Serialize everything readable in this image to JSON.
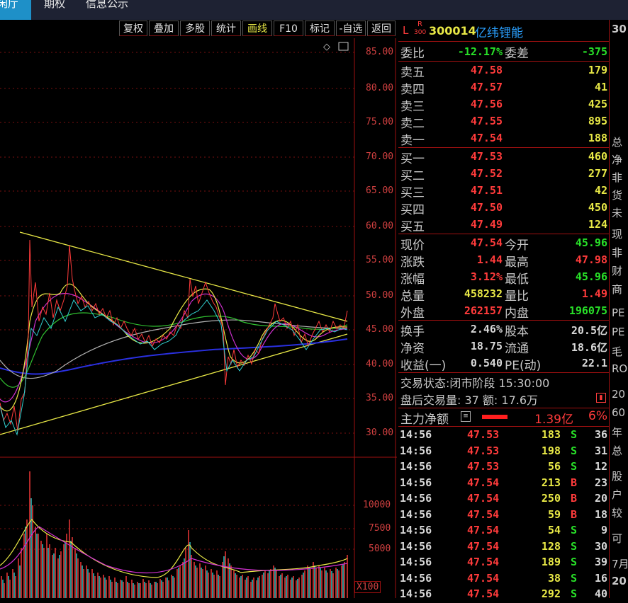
{
  "tabs": [
    "闲厅",
    "期权",
    "信息公示"
  ],
  "toolbar": [
    "复权",
    "叠加",
    "多股",
    "统计",
    "画线",
    "F10",
    "标记",
    "-自选",
    "返回"
  ],
  "price_axis": [
    "85.00",
    "80.00",
    "75.00",
    "70.00",
    "65.00",
    "60.00",
    "55.00",
    "50.00",
    "45.00",
    "40.00",
    "35.00",
    "30.00"
  ],
  "vol_axis": [
    "10000",
    "7500",
    "5000"
  ],
  "vol_unit": "X100",
  "stock": {
    "badge_l": "L",
    "badge_r": "R",
    "badge_300": "300",
    "code": "300014",
    "name": "亿纬锂能"
  },
  "weibi": {
    "label1": "委比",
    "val1": "-12.17%",
    "label2": "委差",
    "val2": "-375"
  },
  "asks": [
    {
      "label": "卖五",
      "price": "47.58",
      "vol": "179"
    },
    {
      "label": "卖四",
      "price": "47.57",
      "vol": "41"
    },
    {
      "label": "卖三",
      "price": "47.56",
      "vol": "425"
    },
    {
      "label": "卖二",
      "price": "47.55",
      "vol": "895"
    },
    {
      "label": "卖一",
      "price": "47.54",
      "vol": "188"
    }
  ],
  "bids": [
    {
      "label": "买一",
      "price": "47.53",
      "vol": "460"
    },
    {
      "label": "买二",
      "price": "47.52",
      "vol": "277"
    },
    {
      "label": "买三",
      "price": "47.51",
      "vol": "42"
    },
    {
      "label": "买四",
      "price": "47.50",
      "vol": "450"
    },
    {
      "label": "买五",
      "price": "47.49",
      "vol": "124"
    }
  ],
  "quote": [
    {
      "l1": "现价",
      "v1": "47.54",
      "c1": "r",
      "l2": "今开",
      "v2": "45.96",
      "c2": "g"
    },
    {
      "l1": "涨跌",
      "v1": "1.44",
      "c1": "r",
      "l2": "最高",
      "v2": "47.98",
      "c2": "r"
    },
    {
      "l1": "涨幅",
      "v1": "3.12%",
      "c1": "r",
      "l2": "最低",
      "v2": "45.96",
      "c2": "g"
    },
    {
      "l1": "总量",
      "v1": "458232",
      "c1": "y",
      "l2": "量比",
      "v2": "1.49",
      "c2": "r"
    },
    {
      "l1": "外盘",
      "v1": "262157",
      "c1": "r",
      "l2": "内盘",
      "v2": "196075",
      "c2": "g"
    }
  ],
  "fund": [
    {
      "l1": "换手",
      "v1": "2.46%",
      "l2": "股本",
      "v2": "20.5亿"
    },
    {
      "l1": "净资",
      "v1": "18.75",
      "l2": "流通",
      "v2": "18.6亿"
    },
    {
      "l1": "收益(一)",
      "v1": "0.540",
      "l2": "PE(动)",
      "v2": "22.1"
    }
  ],
  "status": {
    "line1": "交易状态:闭市阶段 15:30:00",
    "line2": "盘后交易量: 37  额: 17.6万"
  },
  "mainflow": {
    "label": "主力净额",
    "value": "1.39亿",
    "pct": "6%"
  },
  "ticks": [
    {
      "t": "14:56",
      "p": "47.53",
      "v": "183",
      "s": "S",
      "n": "36"
    },
    {
      "t": "14:56",
      "p": "47.53",
      "v": "198",
      "s": "S",
      "n": "31"
    },
    {
      "t": "14:56",
      "p": "47.53",
      "v": "56",
      "s": "S",
      "n": "12"
    },
    {
      "t": "14:56",
      "p": "47.54",
      "v": "213",
      "s": "B",
      "n": "23"
    },
    {
      "t": "14:56",
      "p": "47.54",
      "v": "250",
      "s": "B",
      "n": "20"
    },
    {
      "t": "14:56",
      "p": "47.54",
      "v": "59",
      "s": "B",
      "n": "18"
    },
    {
      "t": "14:56",
      "p": "47.54",
      "v": "54",
      "s": "S",
      "n": "9"
    },
    {
      "t": "14:56",
      "p": "47.54",
      "v": "128",
      "s": "S",
      "n": "30"
    },
    {
      "t": "14:56",
      "p": "47.54",
      "v": "189",
      "s": "S",
      "n": "39"
    },
    {
      "t": "14:56",
      "p": "47.54",
      "v": "38",
      "s": "S",
      "n": "16"
    },
    {
      "t": "14:56",
      "p": "47.54",
      "v": "292",
      "s": "S",
      "n": "40"
    }
  ],
  "far_panel": [
    "30",
    "总",
    "净",
    "非",
    "货",
    "未",
    "现",
    "非",
    "财",
    "商",
    "PE",
    "PE",
    "毛",
    "RO",
    "20",
    "60",
    "年",
    "总",
    "股",
    "户",
    "较",
    "可",
    "7月",
    "20"
  ]
}
